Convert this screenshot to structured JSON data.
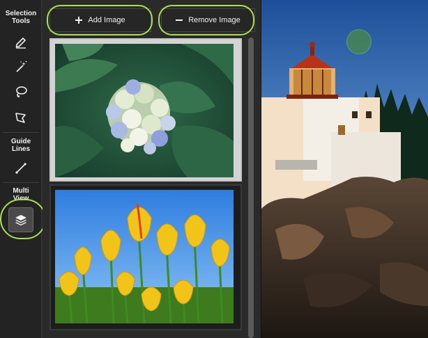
{
  "tools": {
    "selection_heading": [
      "Selection",
      "Tools"
    ],
    "guide_heading": [
      "Guide",
      "Lines"
    ],
    "multiview_heading": [
      "Multi",
      "View"
    ],
    "items": [
      {
        "name": "pencil-icon"
      },
      {
        "name": "magic-wand-icon"
      },
      {
        "name": "lasso-icon"
      },
      {
        "name": "polygon-lasso-icon"
      },
      {
        "name": "line-icon"
      },
      {
        "name": "layers-icon"
      }
    ]
  },
  "toolbar": {
    "add_label": "Add Image",
    "remove_label": "Remove Image"
  },
  "thumbnails": [
    {
      "subject": "blue-white hydrangea",
      "selected": true
    },
    {
      "subject": "yellow tulips",
      "selected": false
    }
  ],
  "colors": {
    "highlight_ring": "#a8e050",
    "panel_bg": "#2a2a2a",
    "tool_strip_bg": "#232323"
  }
}
